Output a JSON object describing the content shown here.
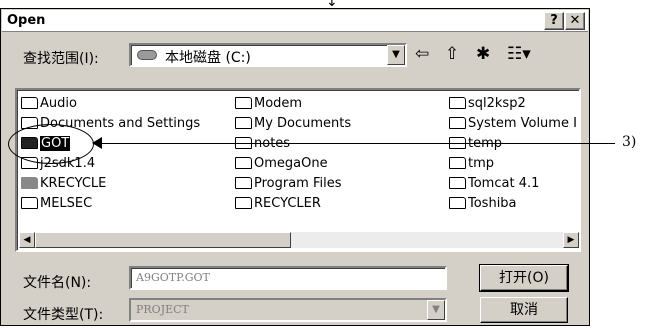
{
  "top_marker": "↓",
  "dialog": {
    "title": "Open",
    "help_label": "?",
    "close_label": "✕"
  },
  "lookin": {
    "label": "查找范围(I):",
    "value": "本地磁盘 (C:)",
    "dropdown_arrow": "▼"
  },
  "toolbar_icons": {
    "back": "⇦",
    "up": "⇧",
    "new_folder": "✱",
    "view": "☷▾"
  },
  "files": {
    "col1": [
      "Audio",
      "Documents and Settings",
      "GOT",
      "j2sdk1.4",
      "KRECYCLE",
      "MELSEC"
    ],
    "col2": [
      "Modem",
      "My Documents",
      "notes",
      "OmegaOne",
      "Program Files",
      "RECYCLER"
    ],
    "col3": [
      "sql2ksp2",
      "System Volume I",
      "temp",
      "tmp",
      "Tomcat 4.1",
      "Toshiba"
    ]
  },
  "scroll": {
    "left": "◀",
    "right": "▶"
  },
  "filename": {
    "label": "文件名(N):",
    "value": "A9GOTP.GOT"
  },
  "filetype": {
    "label": "文件类型(T):",
    "value": "PROJECT",
    "dropdown_arrow": "▼"
  },
  "buttons": {
    "open": "打开(O)",
    "cancel": "取消"
  },
  "callout": {
    "label": "3)"
  }
}
